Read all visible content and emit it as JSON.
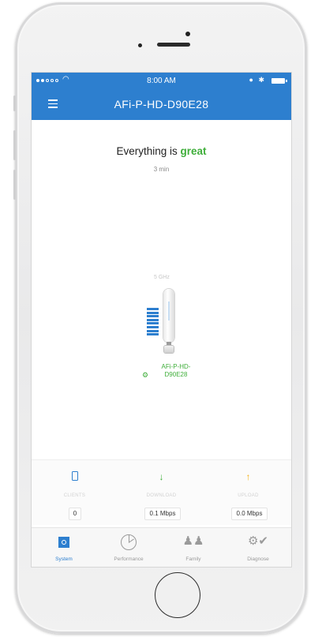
{
  "status_bar": {
    "time": "8:00 AM",
    "icons": "● 8"
  },
  "nav": {
    "title": "AFi-P-HD-D90E28",
    "menu_icon": "hamburger-menu-icon"
  },
  "overview": {
    "headline_prefix": "Everything is ",
    "headline_status": "great",
    "uptime": "3 min",
    "band": "5 GHz",
    "device_label": "AFi-P-HD-D90E28",
    "signal_level": 8,
    "colors": {
      "accent": "#2d7fcf",
      "good": "#3fae3a"
    }
  },
  "stats": [
    {
      "label": "CLIENTS",
      "value": "0",
      "icon": "phone-icon"
    },
    {
      "label": "DOWNLOAD",
      "value": "0.1 Mbps",
      "icon": "down-arrow-icon"
    },
    {
      "label": "UPLOAD",
      "value": "0.0 Mbps",
      "icon": "up-arrow-icon"
    }
  ],
  "tabs": [
    {
      "label": "System",
      "icon": "system-icon",
      "active": true
    },
    {
      "label": "Performance",
      "icon": "performance-icon",
      "active": false
    },
    {
      "label": "Family",
      "icon": "family-icon",
      "active": false
    },
    {
      "label": "Diagnose",
      "icon": "diagnose-icon",
      "active": false
    }
  ]
}
